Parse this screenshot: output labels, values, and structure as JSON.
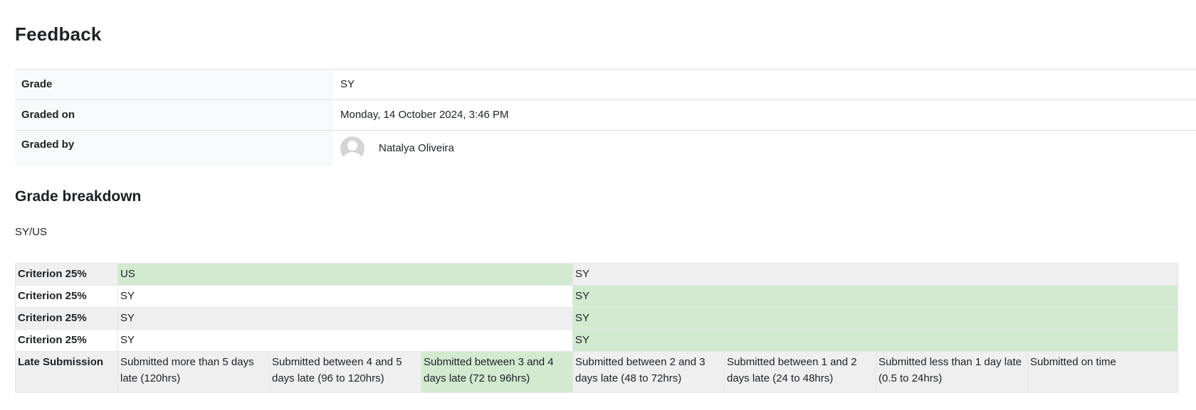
{
  "feedback": {
    "title": "Feedback",
    "rows": {
      "grade": {
        "label": "Grade",
        "value": "SY"
      },
      "graded_on": {
        "label": "Graded on",
        "value": "Monday, 14 October 2024, 3:46 PM"
      },
      "graded_by": {
        "label": "Graded by",
        "value": "Natalya Oliveira"
      }
    }
  },
  "breakdown": {
    "title": "Grade breakdown",
    "scale_name": "SY/US",
    "criteria": [
      {
        "label": "Criterion 25%",
        "levels": [
          "US",
          "SY"
        ],
        "selected": 0
      },
      {
        "label": "Criterion 25%",
        "levels": [
          "SY",
          "SY"
        ],
        "selected": 1
      },
      {
        "label": "Criterion 25%",
        "levels": [
          "SY",
          "SY"
        ],
        "selected": 1
      },
      {
        "label": "Criterion 25%",
        "levels": [
          "SY",
          "SY"
        ],
        "selected": 1
      }
    ],
    "late": {
      "label": "Late Submission",
      "levels": [
        "Submitted more than 5 days late (120hrs)",
        "Submitted between 4 and 5 days late (96 to 120hrs)",
        "Submitted between 3 and 4 days late (72 to 96hrs)",
        "Submitted between 2 and 3 days late (48 to 72hrs)",
        "Submitted between 1 and 2 days late (24 to 48hrs)",
        "Submitted less than 1 day late (0.5 to 24hrs)",
        "Submitted on time"
      ],
      "selected": 2
    }
  },
  "colors": {
    "selected": "#d2ead0",
    "stripe": "#efefef",
    "header_bg": "#f8f9fa"
  }
}
